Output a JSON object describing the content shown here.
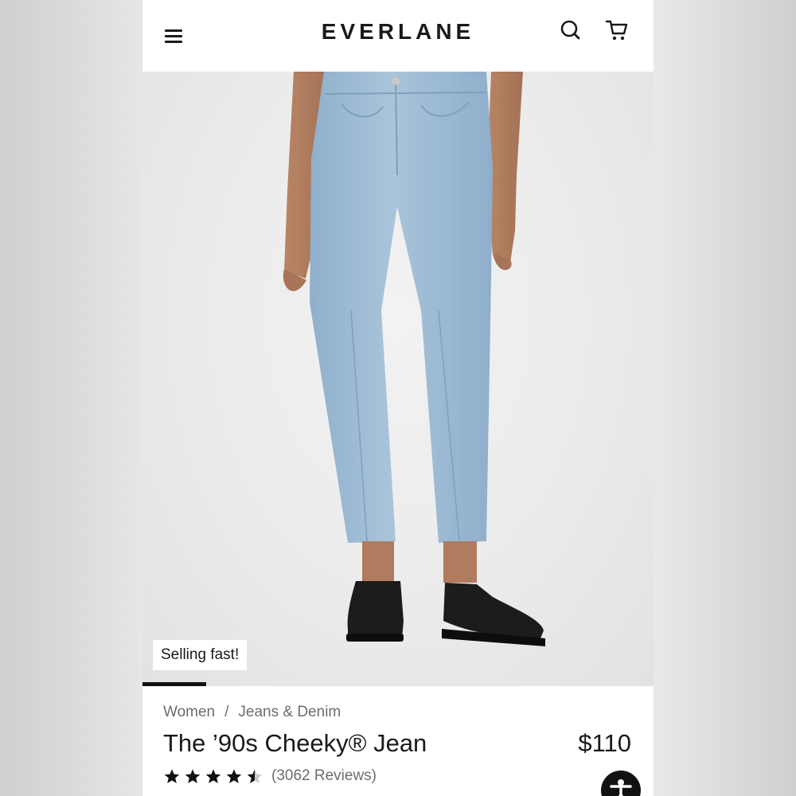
{
  "header": {
    "menu_icon": "hamburger-menu-icon",
    "logo": "EVERLANE",
    "search_icon": "search-icon",
    "cart_icon": "cart-icon"
  },
  "hero": {
    "badge": "Selling fast!",
    "image_progress": 0.125
  },
  "product": {
    "breadcrumb": [
      "Women",
      "Jeans & Denim"
    ],
    "breadcrumb_separator": "/",
    "title": "The ’90s Cheeky® Jean",
    "price": "$110",
    "rating": 4.5,
    "reviews_label": "(3062 Reviews)"
  },
  "accessibility_icon": "accessibility-icon",
  "colors": {
    "denim": "#9fbdd6",
    "denim_dark": "#86a6c2",
    "shoe": "#1c1c1c",
    "text": "#1a1a1a",
    "muted": "#6d6d6d"
  }
}
